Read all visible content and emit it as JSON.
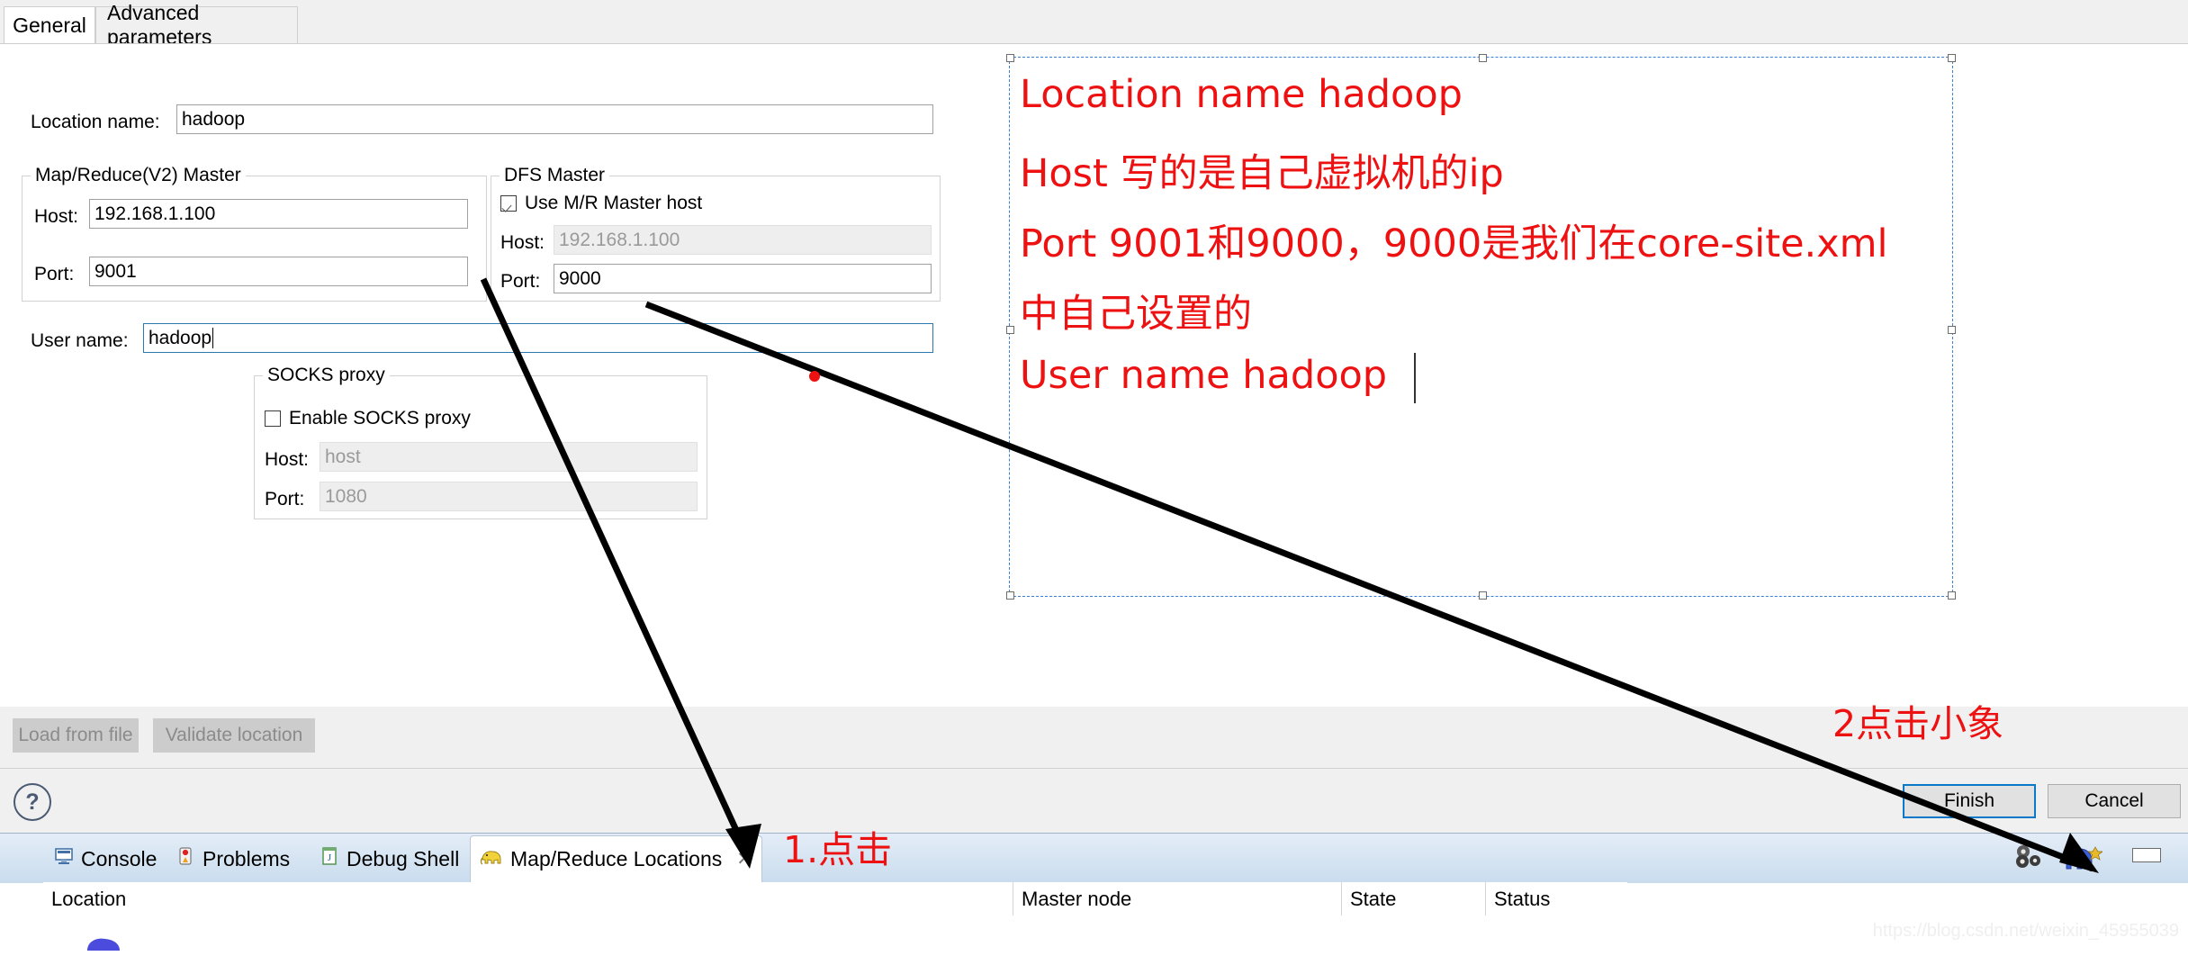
{
  "dialog": {
    "tabs": [
      {
        "label": "General",
        "selected": true
      },
      {
        "label": "Advanced parameters",
        "selected": false
      }
    ],
    "location_name": {
      "label": "Location name:",
      "value": "hadoop",
      "placeholder": ""
    },
    "mr_master": {
      "title": "Map/Reduce(V2) Master",
      "host_label": "Host:",
      "host_value": "192.168.1.100",
      "port_label": "Port:",
      "port_value": "9001"
    },
    "dfs_master": {
      "title": "DFS Master",
      "checkbox_label": "Use M/R Master host",
      "checkbox_checked": true,
      "host_label": "Host:",
      "host_value": "192.168.1.100",
      "host_disabled": true,
      "port_label": "Port:",
      "port_value": "9000"
    },
    "user_name": {
      "label": "User name:",
      "value": "hadoop"
    },
    "socks_proxy": {
      "title": "SOCKS proxy",
      "checkbox_label": "Enable SOCKS proxy",
      "checkbox_checked": false,
      "host_label": "Host:",
      "host_value": "host",
      "port_label": "Port:",
      "port_value": "1080"
    },
    "actions": {
      "load_from_file": "Load from file",
      "validate_location": "Validate location"
    },
    "footer": {
      "help_glyph": "?",
      "finish": "Finish",
      "cancel": "Cancel"
    }
  },
  "bottom_panel": {
    "tabs": [
      {
        "label": "Console",
        "icon": "console-icon",
        "active": false
      },
      {
        "label": "Problems",
        "icon": "problems-icon",
        "active": false
      },
      {
        "label": "Debug Shell",
        "icon": "debug-shell-icon",
        "active": false
      },
      {
        "label": "Map/Reduce Locations",
        "icon": "elephant-icon",
        "active": true
      }
    ],
    "close_tab_glyph": "✕",
    "columns": [
      "Location",
      "Master node",
      "State",
      "Status"
    ],
    "toolbar": {
      "new_location_icon": "new-hadoop-location-icon",
      "settings_icon": "gears-icon",
      "minimize_icon": "minimize-icon"
    }
  },
  "annotations": {
    "note_lines": [
      "Location name   hadoop",
      "Host 写的是自己虚拟机的ip",
      "Port 9001和9000，9000是我们在core-site.xml",
      "中自己设置的",
      "User name  hadoop"
    ],
    "step1": "1.点击",
    "step2": "2点击小象",
    "color": "#ee1111"
  },
  "watermark": "https://blog.csdn.net/weixin_45955039"
}
